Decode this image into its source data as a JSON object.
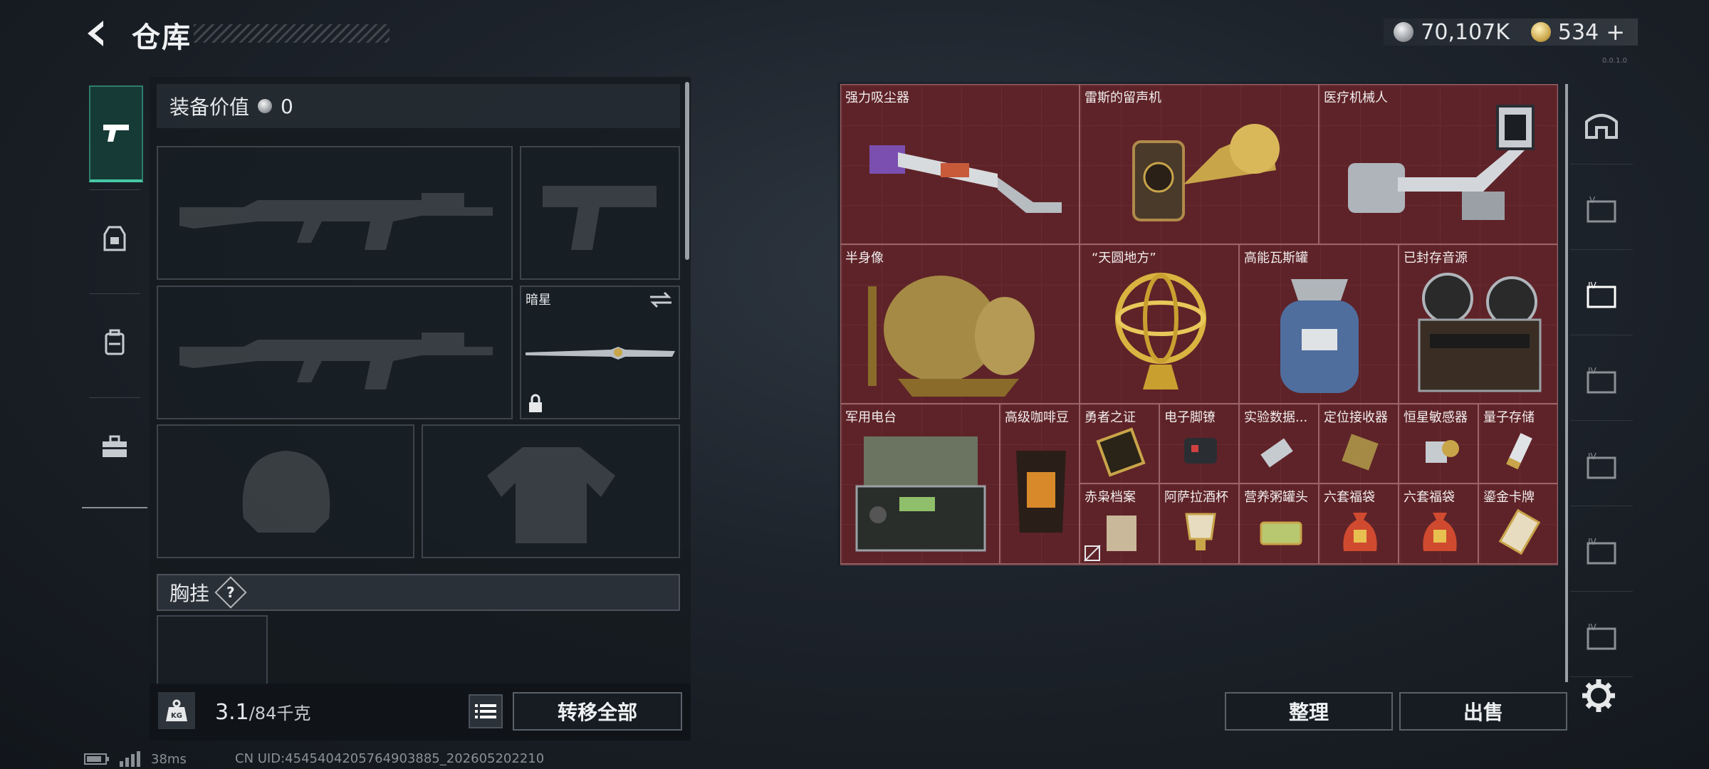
{
  "header": {
    "title": "仓库",
    "currency_silver": "70,107K",
    "currency_gold": "534",
    "gold_add": "+",
    "version": "0.0.1.0"
  },
  "left": {
    "equip_value_label": "装备价值",
    "equip_value": "0",
    "melee_name": "暗星",
    "chest_label": "胸挂",
    "help": "?",
    "weight_value": "3.1",
    "weight_capacity": "/84千克",
    "transfer_all": "转移全部"
  },
  "items": [
    {
      "name": "强力吸尘器"
    },
    {
      "name": "雷斯的留声机"
    },
    {
      "name": "医疗机械人"
    },
    {
      "name": "半身像"
    },
    {
      "name": "“天圆地方”"
    },
    {
      "name": "高能瓦斯罐"
    },
    {
      "name": "已封存音源"
    },
    {
      "name": "军用电台"
    },
    {
      "name": "高级咖啡豆"
    },
    {
      "name": "勇者之证"
    },
    {
      "name": "电子脚镣"
    },
    {
      "name": "实验数据..."
    },
    {
      "name": "定位接收器"
    },
    {
      "name": "恒星敏感器"
    },
    {
      "name": "量子存储"
    },
    {
      "name": "赤枭档案"
    },
    {
      "name": "阿萨拉酒杯"
    },
    {
      "name": "营养粥罐头"
    },
    {
      "name": "六套福袋"
    },
    {
      "name": "六套福袋"
    },
    {
      "name": "鎏金卡牌"
    }
  ],
  "buttons": {
    "organize": "整理",
    "sell": "出售"
  },
  "footer": {
    "ping": "38ms",
    "uid": "CN UID:4545404205764903885_202605202210"
  },
  "colors": {
    "grid_bg": "#5c2125",
    "active_tab": "#48c8a6"
  }
}
